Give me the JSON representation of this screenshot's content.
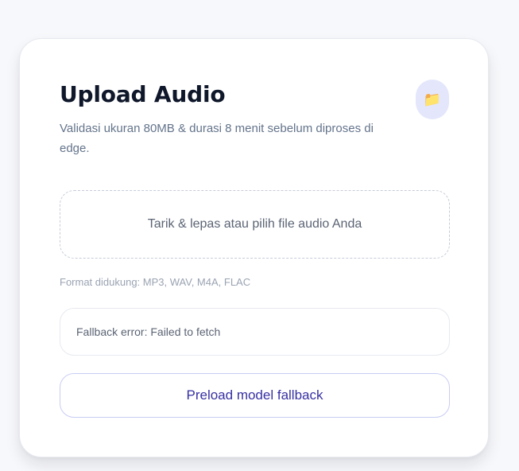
{
  "card": {
    "title": "Upload Audio",
    "subtitle": "Validasi ukuran 80MB & durasi 8 menit sebelum diproses di edge.",
    "icon": "folder-icon",
    "icon_glyph": "📁",
    "dropzone_text": "Tarik & lepas atau pilih file audio Anda",
    "formats_text": "Format didukung: MP3, WAV, M4A, FLAC",
    "error_text": "Fallback error: Failed to fetch",
    "preload_button_label": "Preload model fallback"
  },
  "colors": {
    "accent": "#3730a3",
    "icon_badge_bg": "#e4e7fb",
    "background": "#f7f8fb"
  }
}
